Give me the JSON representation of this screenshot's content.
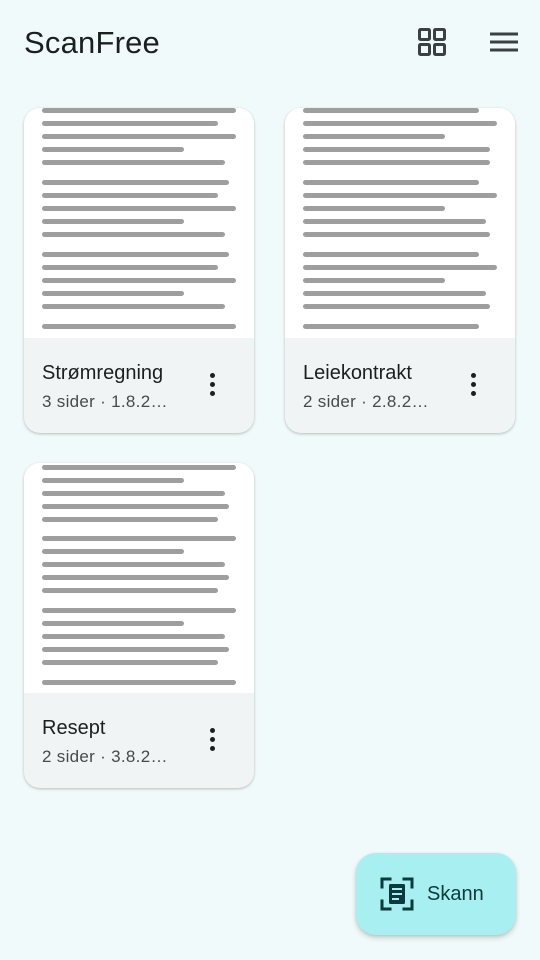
{
  "app": {
    "title": "ScanFree"
  },
  "toolbar": {
    "grid_view_icon": "grid-view-icon",
    "menu_icon": "menu-icon"
  },
  "documents": [
    {
      "title": "Strømregning",
      "meta": "3 sider · 1.8.2…"
    },
    {
      "title": "Leiekontrakt",
      "meta": "2 sider · 2.8.2…"
    },
    {
      "title": "Resept",
      "meta": "2 sider · 3.8.2…"
    }
  ],
  "fab": {
    "label": "Skann",
    "icon": "document-scanner-icon"
  },
  "colors": {
    "background": "#f1fafa",
    "card": "#f1f4f4",
    "fab": "#a7eff0",
    "fab_text": "#0d3b3d",
    "thumbnail_lines": "#9e9e9e"
  }
}
